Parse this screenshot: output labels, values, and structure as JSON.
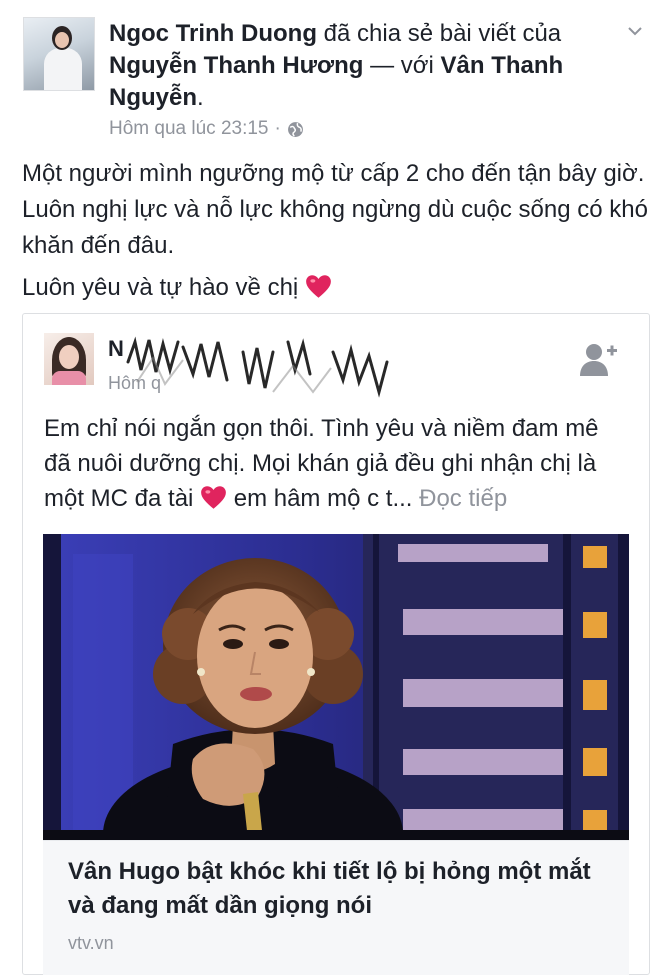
{
  "post": {
    "author": "Ngoc Trinh Duong",
    "shared_text": "đã chia sẻ bài viết của",
    "original_author": "Nguyễn Thanh Hương",
    "with_text": "— với",
    "tagged": "Vân Thanh Nguyễn",
    "period": ".",
    "timestamp": "Hôm qua lúc 23:15",
    "separator": "·",
    "privacy_icon": "globe-icon",
    "menu_icon": "chevron-down-icon",
    "body_line1": "Một người mình ngưỡng mộ từ cấp 2 cho đến tận bây giờ. Luôn nghị lực và nỗ lực không ngừng dù cuộc sống có khó khăn đến đâu.",
    "body_line2": "Luôn yêu và tự hào về chị"
  },
  "shared": {
    "name_visible": "N",
    "meta_visible": "Hôm q",
    "add_friend_icon": "add-friend-icon",
    "text": "Em chỉ nói ngắn gọn thôi. Tình yêu và niềm đam mê đã nuôi dưỡng chị. Mọi khán giả đều ghi nhận chị là một MC đa tài",
    "text_after_heart": " em hâm mộ c t...",
    "see_more": "Đọc tiếp"
  },
  "link": {
    "title": "Vân Hugo bật khóc khi tiết lộ bị hỏng một mắt và đang mất dần giọng nói",
    "domain": "vtv.vn"
  },
  "colors": {
    "text": "#1d2129",
    "meta": "#90949c",
    "heart": "#e0245e",
    "stage_blue": "#2b2d8f"
  }
}
